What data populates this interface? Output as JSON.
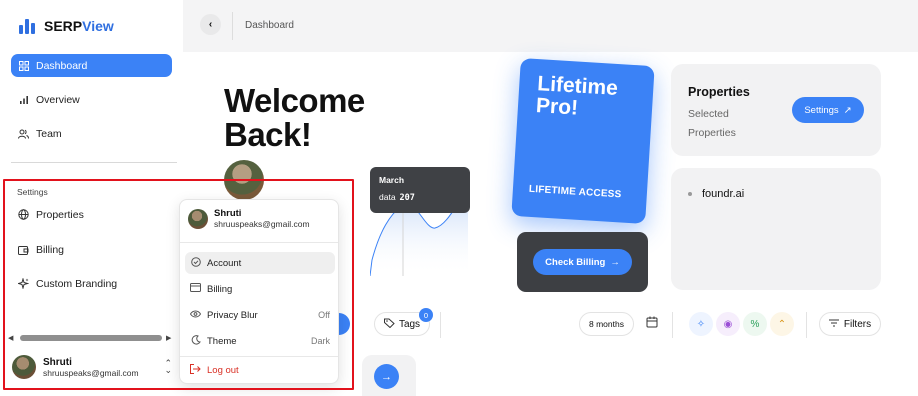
{
  "app": {
    "brand_prefix": "SERP",
    "brand_suffix": "View",
    "accent": "#3b82f6"
  },
  "sidebar": {
    "items": [
      {
        "label": "Dashboard",
        "icon": "grid-icon",
        "active": true
      },
      {
        "label": "Overview",
        "icon": "bar-chart-icon"
      },
      {
        "label": "Team",
        "icon": "users-icon"
      }
    ],
    "settings_title": "Settings",
    "settings_items": [
      {
        "label": "Properties",
        "icon": "globe-icon"
      },
      {
        "label": "Billing",
        "icon": "wallet-icon"
      },
      {
        "label": "Custom Branding",
        "icon": "sparkle-icon"
      }
    ],
    "user": {
      "name": "Shruti",
      "email": "shruuspeaks@gmail.com"
    }
  },
  "topbar": {
    "breadcrumb": "Dashboard"
  },
  "welcome": {
    "line1": "Welcome",
    "line2": "Back!"
  },
  "tooltip": {
    "month": "March",
    "label": "data",
    "value": "207"
  },
  "pro_card": {
    "line1": "Lifetime",
    "line2": "Pro!",
    "subtitle": "LIFETIME ACCESS"
  },
  "billing_card": {
    "button": "Check Billing"
  },
  "properties_card": {
    "title": "Properties",
    "subtitle_line1": "Selected",
    "subtitle_line2": "Properties",
    "button": "Settings"
  },
  "sites": [
    "foundr.ai"
  ],
  "toolbar": {
    "tags_label": "Tags",
    "tags_count": "0",
    "range_label": "8 months",
    "filters_label": "Filters"
  },
  "popup": {
    "name": "Shruti",
    "email": "shruuspeaks@gmail.com",
    "items": [
      {
        "label": "Account",
        "icon": "account-icon",
        "right": ""
      },
      {
        "label": "Billing",
        "icon": "credit-card-icon",
        "right": ""
      },
      {
        "label": "Privacy Blur",
        "icon": "eye-icon",
        "right": "Off"
      },
      {
        "label": "Theme",
        "icon": "moon-icon",
        "right": "Dark"
      }
    ],
    "logout": "Log out"
  }
}
